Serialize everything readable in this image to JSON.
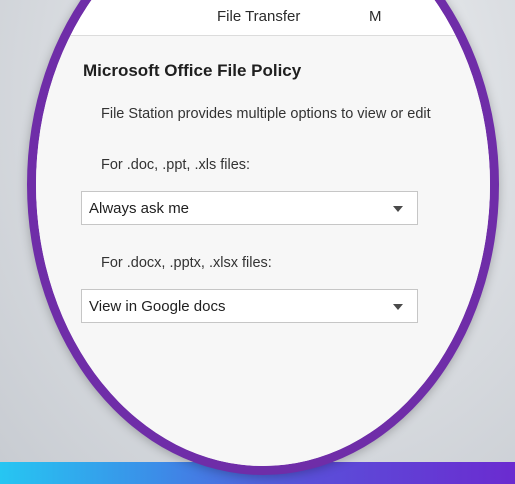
{
  "tabs": {
    "file_transfer": "File Transfer",
    "next_partial": "M"
  },
  "policy": {
    "title": "Microsoft Office File Policy",
    "description": "File Station provides multiple options to view or edit",
    "legacy_label": "For .doc, .ppt, .xls files:",
    "legacy_value": "Always ask me",
    "modern_label": "For .docx, .pptx, .xlsx files:",
    "modern_value": "View in Google docs"
  },
  "colors": {
    "ring": "#6f2da8",
    "bar_start": "#26c6f2",
    "bar_end": "#6b2bd0"
  },
  "icons": {
    "dropdown": "chevron-down-icon"
  }
}
